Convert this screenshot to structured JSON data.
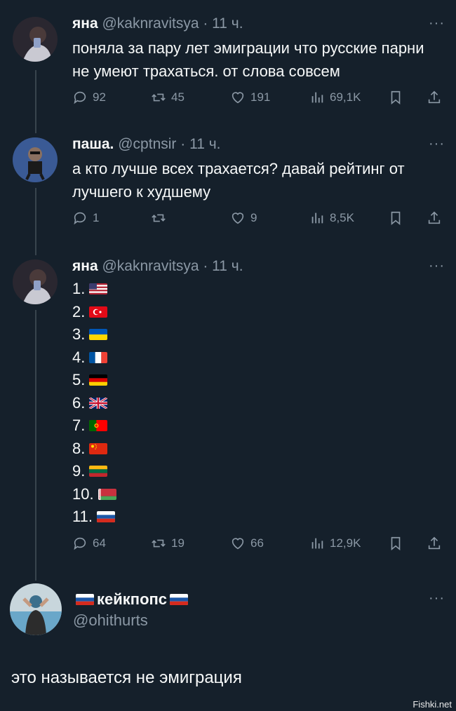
{
  "tweets": [
    {
      "name": "яна",
      "handle": "@kaknravitsya",
      "time": "· 11 ч.",
      "text": "поняла за пару лет эмиграции что русские парни не умеют трахаться. от слова совсем",
      "replies": "92",
      "retweets": "45",
      "likes": "191",
      "views": "69,1K"
    },
    {
      "name": "паша.",
      "handle": "@cptnsir",
      "time": "· 11 ч.",
      "text": "а кто лучше всех трахается? давай рейтинг от лучшего к худшему",
      "replies": "1",
      "retweets": "",
      "likes": "9",
      "views": "8,5K"
    },
    {
      "name": "яна",
      "handle": "@kaknravitsya",
      "time": "· 11 ч.",
      "list": [
        {
          "num": "1.",
          "flag": "us"
        },
        {
          "num": "2.",
          "flag": "tr"
        },
        {
          "num": "3.",
          "flag": "ua"
        },
        {
          "num": "4.",
          "flag": "fr"
        },
        {
          "num": "5.",
          "flag": "de"
        },
        {
          "num": "6.",
          "flag": "gb"
        },
        {
          "num": "7.",
          "flag": "pt"
        },
        {
          "num": "8.",
          "flag": "cn"
        },
        {
          "num": "9.",
          "flag": "lt"
        },
        {
          "num": "10.",
          "flag": "by"
        },
        {
          "num": "11.",
          "flag": "ru"
        }
      ],
      "replies": "64",
      "retweets": "19",
      "likes": "66",
      "views": "12,9K"
    }
  ],
  "reply_author": {
    "name": "кейкпопс",
    "handle": "@ohithurts",
    "text": "это называется не эмиграция"
  },
  "more_glyph": "···",
  "watermark": "Fishki.net",
  "colors": {
    "background": "#15202b",
    "secondary": "#8b98a5",
    "line": "#38444d"
  }
}
